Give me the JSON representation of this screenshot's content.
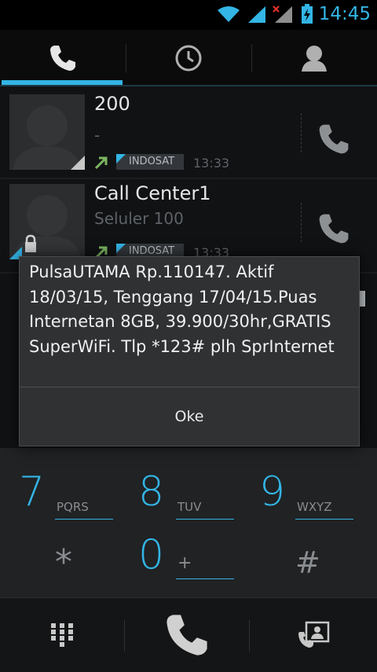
{
  "status_bar": {
    "time": "14:45",
    "icons": [
      "wifi-icon",
      "signal-icon",
      "signal-no-data-icon",
      "battery-charging-icon"
    ],
    "accent": "#33b5e5"
  },
  "tabs": [
    {
      "name": "phone",
      "icon": "phone-icon",
      "selected": true
    },
    {
      "name": "recent",
      "icon": "clock-icon",
      "selected": false
    },
    {
      "name": "contacts",
      "icon": "person-icon",
      "selected": false
    }
  ],
  "call_log": [
    {
      "name": "200",
      "sub": "-",
      "sim": "INDOSAT",
      "time": "13:33",
      "icon": "outgoing-call-icon"
    },
    {
      "name": "Call Center1",
      "sub": "Seluler 100",
      "sim": "INDOSAT",
      "time": "13:33",
      "icon": "outgoing-call-icon"
    }
  ],
  "dialpad": {
    "keys": [
      {
        "digit": "7",
        "letters": "PQRS"
      },
      {
        "digit": "8",
        "letters": "TUV"
      },
      {
        "digit": "9",
        "letters": "WXYZ"
      },
      {
        "digit": "*",
        "letters": ""
      },
      {
        "digit": "0",
        "letters": "+"
      },
      {
        "digit": "#",
        "letters": ""
      }
    ]
  },
  "bottom_bar": {
    "icons": [
      "dialpad-icon",
      "call-icon",
      "contact-card-icon"
    ]
  },
  "dialog": {
    "message": "PulsaUTAMA Rp.110147. Aktif 18/03/15, Tenggang 17/04/15.Puas Internetan 8GB, 39.900/30hr,GRATIS SuperWiFi. Tlp *123# plh SprInternet",
    "button": "Oke"
  }
}
